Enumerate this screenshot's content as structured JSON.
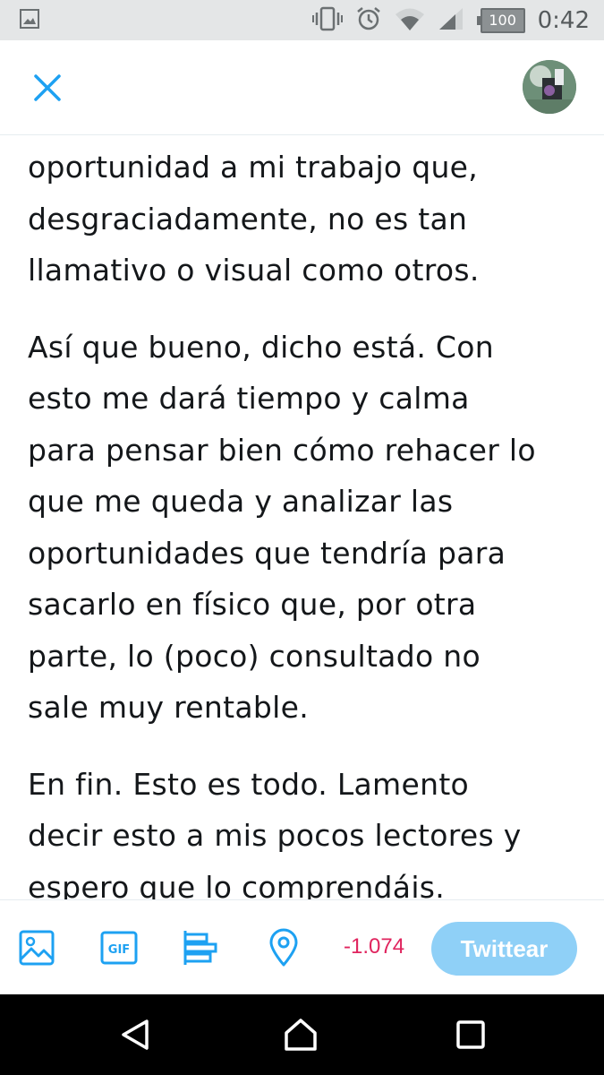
{
  "status_bar": {
    "time": "0:42",
    "battery": "100",
    "icons": [
      "image-notification-icon",
      "vibrate-icon",
      "alarm-icon",
      "wifi-icon",
      "signal-icon",
      "battery-icon"
    ]
  },
  "header": {
    "close_icon": "close-icon",
    "avatar": "user-avatar"
  },
  "tweet": {
    "paragraphs": [
      [
        "oportunidad a mi trabajo que,",
        "desgraciadamente,  no es tan",
        "llamativo o visual como otros."
      ],
      [
        "Así que bueno,  dicho está.  Con",
        "esto me dará tiempo y calma",
        "para pensar bien cómo rehacer lo",
        "que me queda y analizar las",
        "oportunidades que tendría para",
        "sacarlo en físico que, por otra",
        "parte, lo (poco) consultado no",
        "sale muy rentable."
      ],
      [
        "En fin. Esto es todo. Lamento",
        "decir esto a mis pocos lectores y",
        "espero que lo comprendáis."
      ]
    ]
  },
  "toolbar": {
    "icons": [
      "image-icon",
      "gif-icon",
      "poll-icon",
      "location-icon"
    ],
    "char_count": "-1.074",
    "tweet_label": "Twittear",
    "accent_color": "#1da1f2",
    "button_color": "#8fd0f7",
    "count_color": "#e0245e"
  },
  "nav": {
    "icons": [
      "back-icon",
      "home-icon",
      "recents-icon"
    ]
  }
}
